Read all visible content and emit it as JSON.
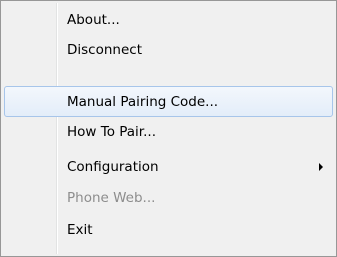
{
  "context_menu": {
    "items": [
      {
        "label": "About...",
        "enabled": true,
        "highlighted": false,
        "has_submenu": false
      },
      {
        "label": "Disconnect",
        "enabled": true,
        "highlighted": false,
        "has_submenu": false
      },
      {
        "label": "Manual Pairing Code...",
        "enabled": true,
        "highlighted": true,
        "has_submenu": false
      },
      {
        "label": "How To Pair...",
        "enabled": true,
        "highlighted": false,
        "has_submenu": false
      },
      {
        "label": "Configuration",
        "enabled": true,
        "highlighted": false,
        "has_submenu": true
      },
      {
        "label": "Phone Web...",
        "enabled": false,
        "highlighted": false,
        "has_submenu": false
      },
      {
        "label": "Exit",
        "enabled": true,
        "highlighted": false,
        "has_submenu": false
      }
    ],
    "colors": {
      "background": "#f0f0f0",
      "border": "#979797",
      "highlight_border": "#a7c5ea",
      "disabled_text": "#8d8d8d"
    },
    "icons": {
      "submenu_arrow": "caret-right-icon"
    }
  }
}
